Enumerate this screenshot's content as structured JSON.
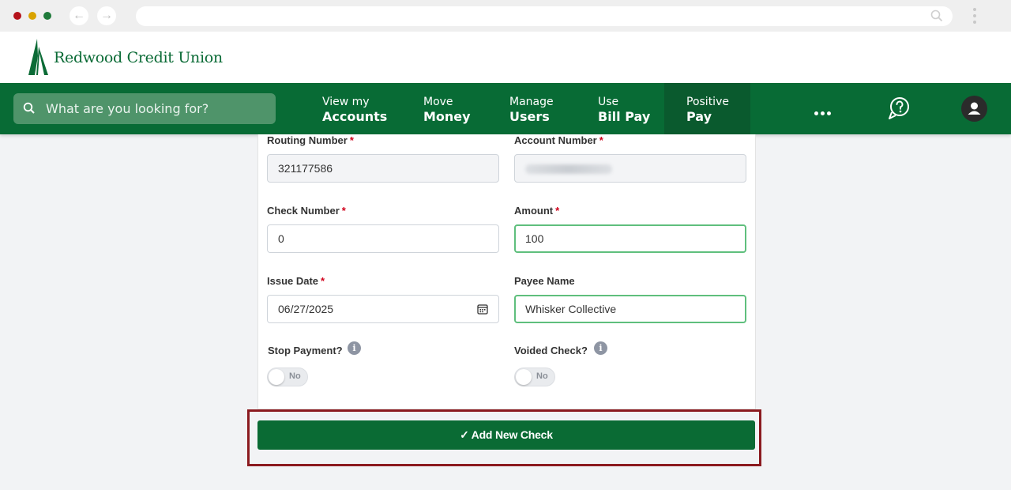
{
  "brand": {
    "name": "Redwood Credit Union",
    "green": "#086b35"
  },
  "header": {
    "search_placeholder": "What are you looking for?",
    "nav": [
      {
        "line1": "View my",
        "line2": "Accounts"
      },
      {
        "line1": "Move",
        "line2": "Money"
      },
      {
        "line1": "Manage",
        "line2": "Users"
      },
      {
        "line1": "Use",
        "line2": "Bill Pay"
      },
      {
        "line1": "Positive",
        "line2": "Pay",
        "active": true
      }
    ],
    "icons": [
      "more-icon",
      "help-chat-icon",
      "profile-icon"
    ]
  },
  "form": {
    "routing_number": {
      "label": "Routing Number",
      "value": "321177586"
    },
    "account_number": {
      "label": "Account Number",
      "value": ""
    },
    "check_number": {
      "label": "Check Number",
      "value": "0"
    },
    "amount": {
      "label": "Amount",
      "value": "100"
    },
    "issue_date": {
      "label": "Issue Date",
      "value": "06/27/2025"
    },
    "payee_name": {
      "label": "Payee Name",
      "value": "Whisker Collective"
    },
    "stop_payment": {
      "label": "Stop Payment?",
      "toggle": "No"
    },
    "voided_check": {
      "label": "Voided Check?",
      "toggle": "No"
    },
    "required_mark": "*",
    "submit_label": "Add New Check",
    "submit_icon": "✓"
  }
}
